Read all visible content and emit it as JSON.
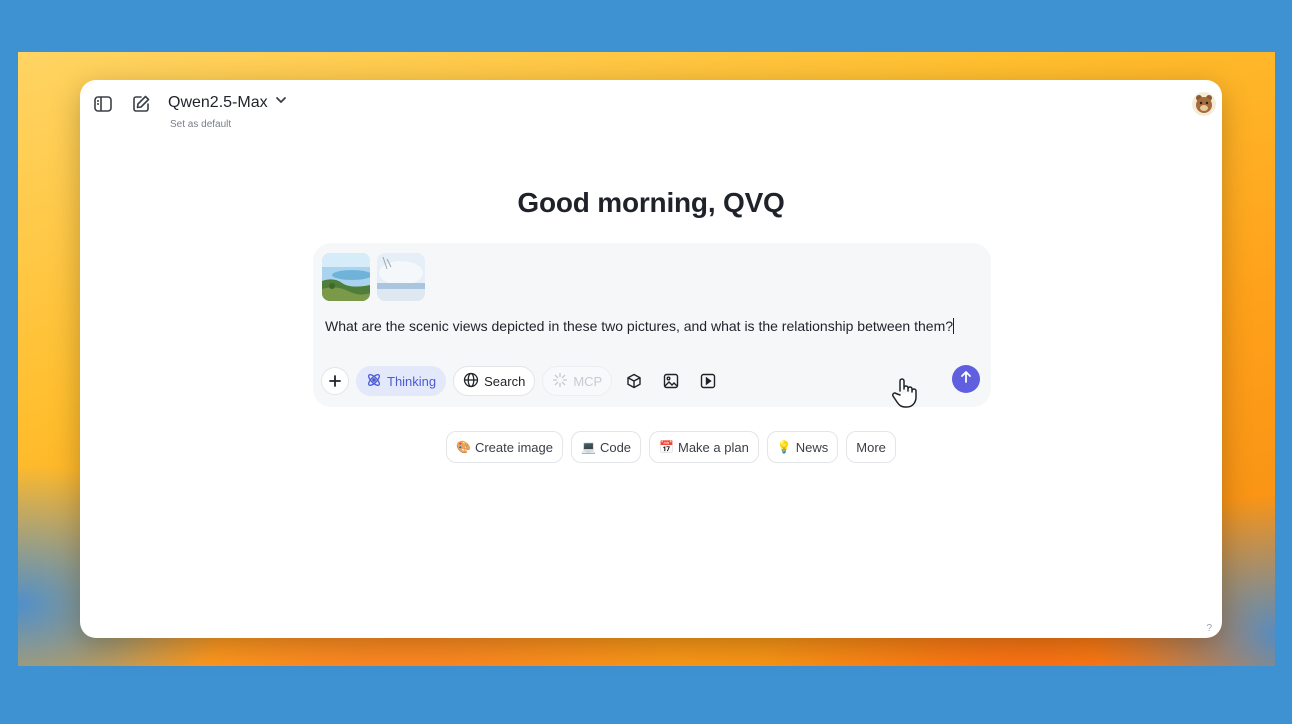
{
  "header": {
    "model_name": "Qwen2.5-Max",
    "set_default_label": "Set as default"
  },
  "main": {
    "greeting": "Good morning, QVQ"
  },
  "composer": {
    "prompt": "What are the scenic views depicted in these two pictures, and what is the relationship between them?",
    "tools": {
      "thinking": "Thinking",
      "search": "Search",
      "mcp": "MCP"
    },
    "thinking_active": true,
    "mcp_disabled": true
  },
  "suggestions": [
    {
      "icon": "palette",
      "label": "Create image"
    },
    {
      "icon": "laptop",
      "label": "Code"
    },
    {
      "icon": "calendar",
      "label": "Make a plan"
    },
    {
      "icon": "lightbulb",
      "label": "News"
    },
    {
      "label": "More"
    }
  ],
  "footer": {
    "help": "?"
  },
  "colors": {
    "accent": "#5f5fe0",
    "thinking_bg": "#e3e8fb",
    "thinking_fg": "#4b5bd4"
  }
}
